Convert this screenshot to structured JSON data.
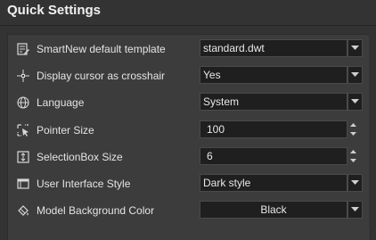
{
  "title": "Quick Settings",
  "rows": [
    {
      "label": "SmartNew default template",
      "value": "standard.dwt",
      "control": "dropdown",
      "icon": "template-icon"
    },
    {
      "label": "Display cursor as crosshair",
      "value": "Yes",
      "control": "dropdown",
      "icon": "crosshair-icon"
    },
    {
      "label": "Language",
      "value": "System",
      "control": "dropdown",
      "icon": "globe-icon"
    },
    {
      "label": "Pointer Size",
      "value": "100",
      "control": "spinner",
      "icon": "pointer-size-icon"
    },
    {
      "label": "SelectionBox Size",
      "value": "6",
      "control": "spinner",
      "icon": "selection-box-icon"
    },
    {
      "label": "User Interface Style",
      "value": "Dark style",
      "control": "dropdown",
      "icon": "window-style-icon"
    },
    {
      "label": "Model Background Color",
      "value": "Black",
      "control": "dropdown",
      "icon": "paint-bucket-icon"
    }
  ]
}
